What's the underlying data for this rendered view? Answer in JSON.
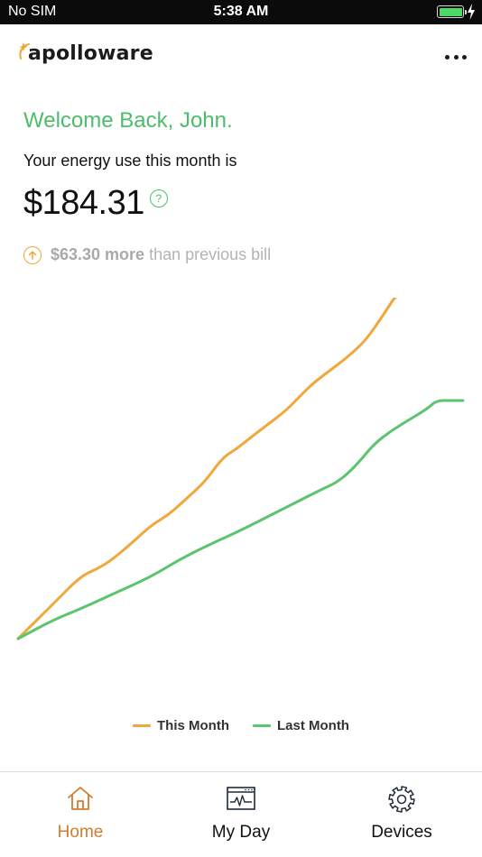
{
  "status_bar": {
    "carrier": "No SIM",
    "time": "5:38 AM",
    "battery_level": 1.0
  },
  "header": {
    "brand": "apolloware",
    "menu_icon": "more-horizontal-icon"
  },
  "welcome": "Welcome Back, John.",
  "energy": {
    "label": "Your energy use this month is",
    "amount": "$184.31",
    "help_icon": "question-icon",
    "help_glyph": "?"
  },
  "comparison": {
    "icon": "arrow-up-circle-icon",
    "amount": "$63.30 more",
    "text": "than previous bill"
  },
  "colors": {
    "accent_green": "#4cbd6a",
    "accent_orange": "#f0a73c",
    "this_month": "#f0a73c",
    "last_month": "#5cc46f",
    "active_tab": "#d27c2e"
  },
  "chart_data": {
    "type": "line",
    "title": "",
    "xlabel": "",
    "ylabel": "",
    "xlim": [
      0,
      1
    ],
    "ylim": [
      0,
      1
    ],
    "grid": false,
    "legend": "bottom",
    "series": [
      {
        "name": "This Month",
        "x": [
          0.0,
          0.08,
          0.14,
          0.18,
          0.21,
          0.26,
          0.3,
          0.34,
          0.38,
          0.42,
          0.46,
          0.49,
          0.52,
          0.56,
          0.6,
          0.63,
          0.66,
          0.7,
          0.74,
          0.78,
          0.81,
          0.83,
          0.85,
          0.87,
          0.88,
          0.9
        ],
        "y": [
          0.0,
          0.13,
          0.23,
          0.26,
          0.29,
          0.36,
          0.42,
          0.46,
          0.52,
          0.58,
          0.67,
          0.7,
          0.74,
          0.79,
          0.84,
          0.89,
          0.94,
          0.99,
          1.04,
          1.1,
          1.17,
          1.22,
          1.27,
          1.28,
          1.28,
          1.28
        ],
        "end_marker": true
      },
      {
        "name": "Last Month",
        "x": [
          0.0,
          0.08,
          0.14,
          0.22,
          0.3,
          0.36,
          0.42,
          0.5,
          0.56,
          0.62,
          0.68,
          0.72,
          0.76,
          0.8,
          0.84,
          0.88,
          0.92,
          0.94,
          0.97,
          1.0
        ],
        "y": [
          0.0,
          0.07,
          0.11,
          0.17,
          0.23,
          0.29,
          0.34,
          0.4,
          0.45,
          0.5,
          0.55,
          0.58,
          0.64,
          0.72,
          0.77,
          0.81,
          0.85,
          0.88,
          0.88,
          0.88
        ]
      }
    ]
  },
  "tabs": [
    {
      "label": "Home",
      "icon": "home-icon",
      "active": true
    },
    {
      "label": "My Day",
      "icon": "my-day-icon",
      "active": false
    },
    {
      "label": "Devices",
      "icon": "gear-icon",
      "active": false
    }
  ]
}
